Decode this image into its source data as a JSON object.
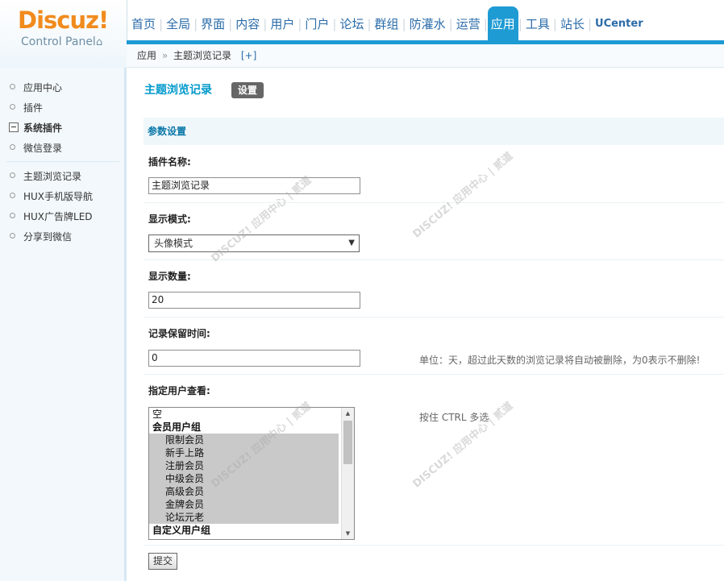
{
  "logo": {
    "brand": "Discuz!",
    "subtitle": "Control Panel"
  },
  "nav": {
    "items": [
      "首页",
      "全局",
      "界面",
      "内容",
      "用户",
      "门户",
      "论坛",
      "群组",
      "防灌水",
      "运营",
      "应用",
      "工具",
      "站长",
      "UCenter"
    ],
    "active": "应用",
    "colors": {
      "accent": "#1f9bd4",
      "link": "#2a6ba8"
    }
  },
  "breadcrumb": {
    "section": "应用",
    "separator": "»",
    "page": "主题浏览记录",
    "add": "[+]"
  },
  "sidebar": {
    "top_items": [
      "应用中心",
      "插件"
    ],
    "group_label": "系统插件",
    "group_items": [
      "微信登录"
    ],
    "plugin_items": [
      "主题浏览记录",
      "HUX手机版导航",
      "HUX广告牌LED",
      "分享到微信"
    ]
  },
  "main": {
    "title": "主题浏览记录",
    "tab_settings": "设置",
    "section_title": "参数设置",
    "fields": {
      "plugin_name": {
        "label": "插件名称:",
        "value": "主题浏览记录"
      },
      "display_mode": {
        "label": "显示模式:",
        "value": "头像模式"
      },
      "display_count": {
        "label": "显示数量:",
        "value": "20"
      },
      "retention": {
        "label": "记录保留时间:",
        "value": "0",
        "tip": "单位：天，超过此天数的浏览记录将自动被删除，为0表示不删除!"
      },
      "allowed_users": {
        "label": "指定用户查看:",
        "tip": "按住 CTRL 多选",
        "options": [
          {
            "text": "空",
            "kind": "plain"
          },
          {
            "text": "会员用户组",
            "kind": "group"
          },
          {
            "text": "限制会员",
            "kind": "sub"
          },
          {
            "text": "新手上路",
            "kind": "sub"
          },
          {
            "text": "注册会员",
            "kind": "sub"
          },
          {
            "text": "中级会员",
            "kind": "sub"
          },
          {
            "text": "高级会员",
            "kind": "sub"
          },
          {
            "text": "金牌会员",
            "kind": "sub"
          },
          {
            "text": "论坛元老",
            "kind": "sub"
          },
          {
            "text": "自定义用户组",
            "kind": "group"
          }
        ]
      }
    },
    "submit_label": "提交"
  }
}
